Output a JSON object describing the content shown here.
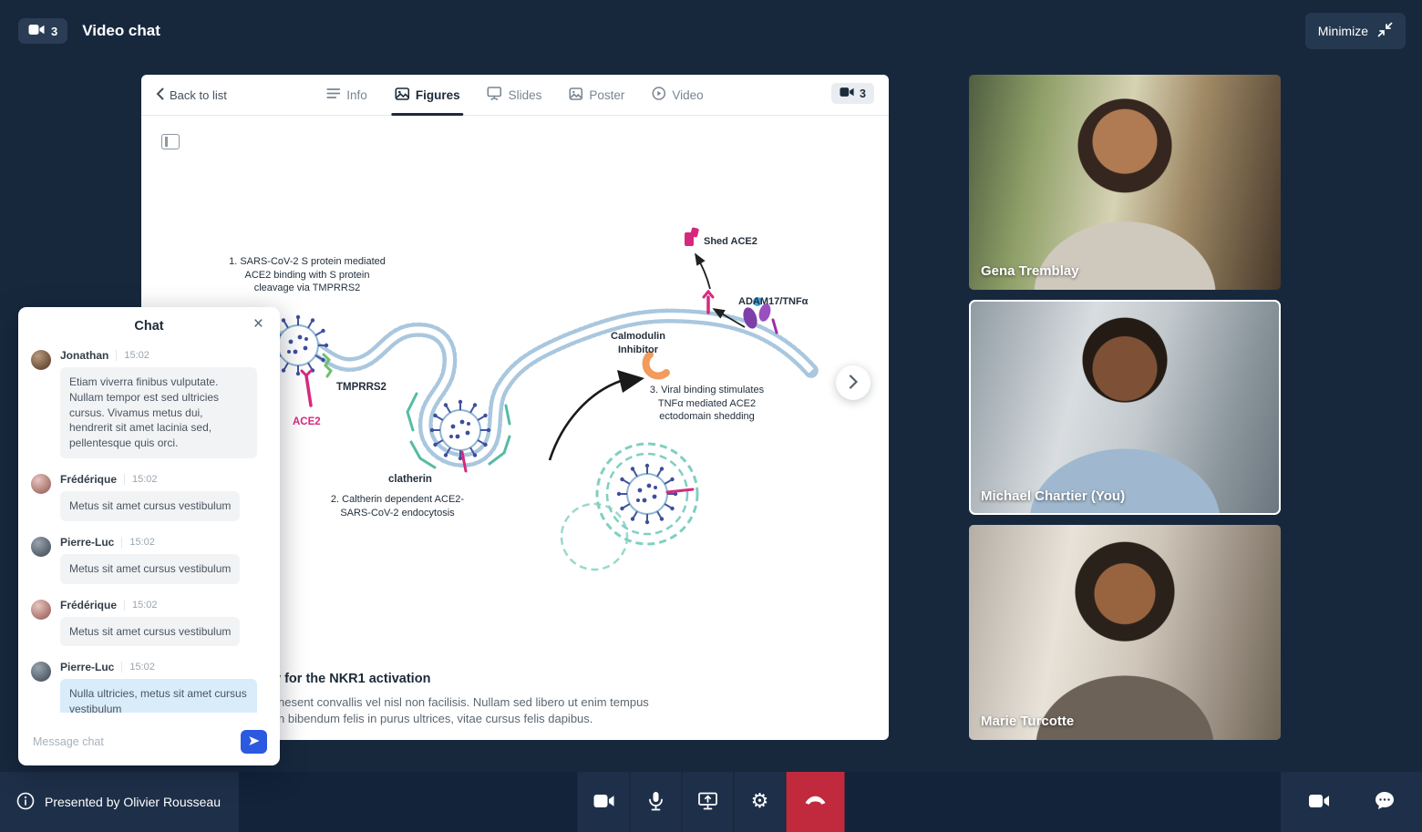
{
  "app": {
    "title": "Video chat",
    "camera_count": "3",
    "minimize_label": "Minimize"
  },
  "viewer": {
    "back_label": "Back to list",
    "badge_count": "3",
    "tabs": [
      {
        "label": "Info",
        "icon": "list-icon"
      },
      {
        "label": "Figures",
        "icon": "image-icon"
      },
      {
        "label": "Slides",
        "icon": "presentation-icon"
      },
      {
        "label": "Poster",
        "icon": "poster-icon"
      },
      {
        "label": "Video",
        "icon": "play-icon"
      }
    ],
    "active_tab": "Figures",
    "caption": {
      "title": "y for the NKR1 activation",
      "body_line1": "nesent convallis vel nisl non facilisis. Nullam sed libero ut enim tempus",
      "body_line2": "n bibendum felis in purus ultrices, vitae cursus felis dapibus."
    }
  },
  "figure": {
    "labels": {
      "step1": "1. SARS-CoV-2 S protein mediated ACE2 binding with S protein cleavage via TMPRRS2",
      "step2": "2. Caltherin dependent ACE2-SARS-CoV-2 endocytosis",
      "step3": "3. Viral binding stimulates TNFα mediated ACE2 ectodomain shedding",
      "shed_ace2": "Shed ACE2",
      "adam17": "ADAM17/TNFα",
      "calmodulin": "Calmodulin Inhibitor",
      "tmprrs2": "TMPRRS2",
      "ace2": "ACE2",
      "clatherin": "clatherin"
    }
  },
  "chat": {
    "title": "Chat",
    "input_placeholder": "Message chat",
    "messages": [
      {
        "name": "Jonathan",
        "time": "15:02",
        "text": "Etiam viverra finibus vulputate. Nullam tempor est sed ultricies cursus. Vivamus metus dui, hendrerit sit amet lacinia sed, pellentesque quis orci."
      },
      {
        "name": "Frédérique",
        "time": "15:02",
        "text": "Metus sit amet cursus vestibulum"
      },
      {
        "name": "Pierre-Luc",
        "time": "15:02",
        "text": "Metus sit amet cursus vestibulum"
      },
      {
        "name": "Frédérique",
        "time": "15:02",
        "text": "Metus sit amet cursus vestibulum"
      },
      {
        "name": "Pierre-Luc",
        "time": "15:02",
        "text": "Nulla ultricies, metus sit amet cursus vestibulum"
      }
    ]
  },
  "participants": [
    {
      "name": "Gena Tremblay"
    },
    {
      "name": "Michael Chartier (You)"
    },
    {
      "name": "Marie Turcotte"
    }
  ],
  "footer": {
    "presented_by": "Presented by Olivier Rousseau",
    "control_icons": [
      "camera-icon",
      "microphone-icon",
      "screen-share-icon",
      "settings-icon",
      "end-call-icon"
    ],
    "right_icons": [
      "camera-icon",
      "chat-bubble-icon"
    ]
  },
  "colors": {
    "navy_background": "#17283D",
    "footer_section": "#1E3049",
    "accent_blue": "#2B59E0",
    "danger_red": "#C12A3C",
    "teal": "#56BBA4",
    "magenta": "#D6297E",
    "membrane_blue": "#A9C7DE"
  }
}
